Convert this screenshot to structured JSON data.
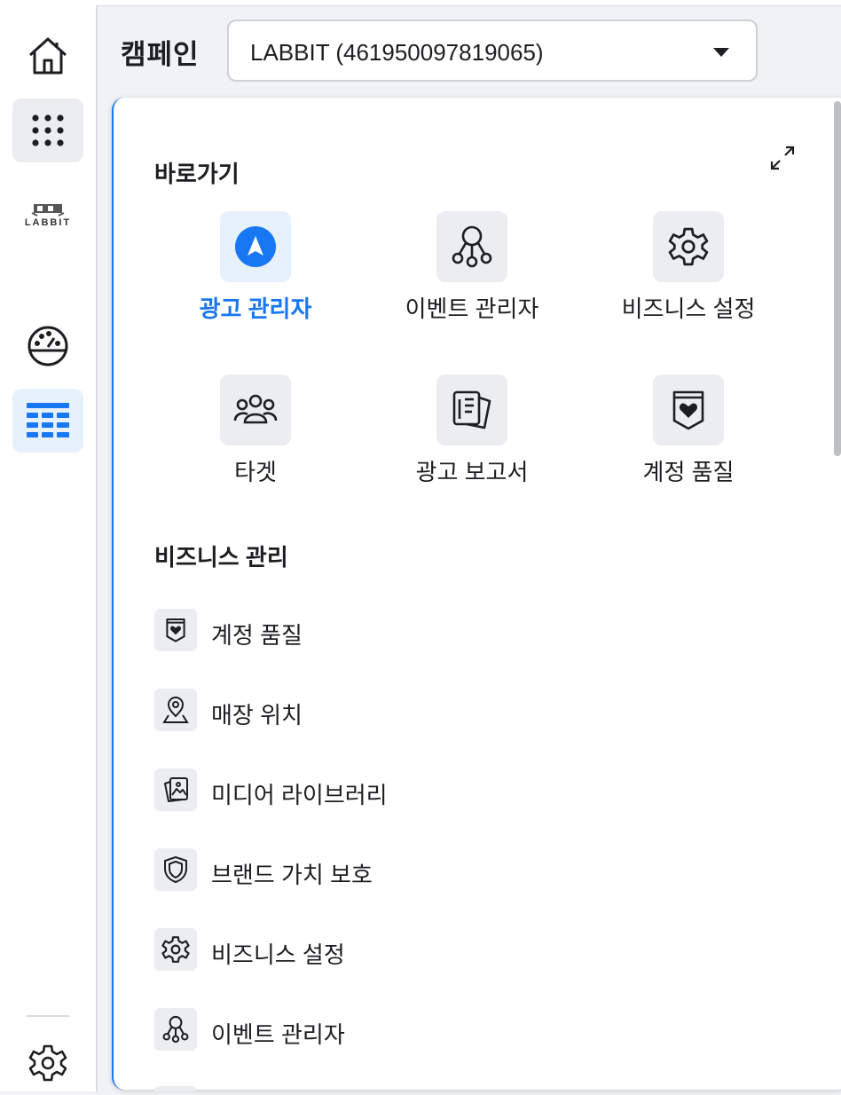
{
  "header": {
    "title": "캠페인",
    "account_select_value": "LABBIT (461950097819065)"
  },
  "rail": {
    "logo_text": "LABBIT"
  },
  "panel": {
    "shortcuts_title": "바로가기",
    "shortcuts": [
      {
        "label": "광고 관리자",
        "icon": "ads-manager-icon",
        "active": true
      },
      {
        "label": "이벤트 관리자",
        "icon": "events-manager-icon",
        "active": false
      },
      {
        "label": "비즈니스 설정",
        "icon": "gear-icon",
        "active": false
      },
      {
        "label": "타겟",
        "icon": "audience-icon",
        "active": false
      },
      {
        "label": "광고 보고서",
        "icon": "ads-reporting-icon",
        "active": false
      },
      {
        "label": "계정 품질",
        "icon": "account-quality-icon",
        "active": false
      }
    ],
    "business_title": "비즈니스 관리",
    "business_items": [
      {
        "label": "계정 품질",
        "icon": "account-quality-icon"
      },
      {
        "label": "매장 위치",
        "icon": "store-location-icon"
      },
      {
        "label": "미디어 라이브러리",
        "icon": "media-library-icon"
      },
      {
        "label": "브랜드 가치 보호",
        "icon": "shield-icon"
      },
      {
        "label": "비즈니스 설정",
        "icon": "gear-icon"
      },
      {
        "label": "이벤트 관리자",
        "icon": "events-manager-icon"
      }
    ]
  },
  "colors": {
    "accent": "#1877f2",
    "active_bg": "#e7f0fd",
    "icon_bg": "#ebedf0"
  }
}
